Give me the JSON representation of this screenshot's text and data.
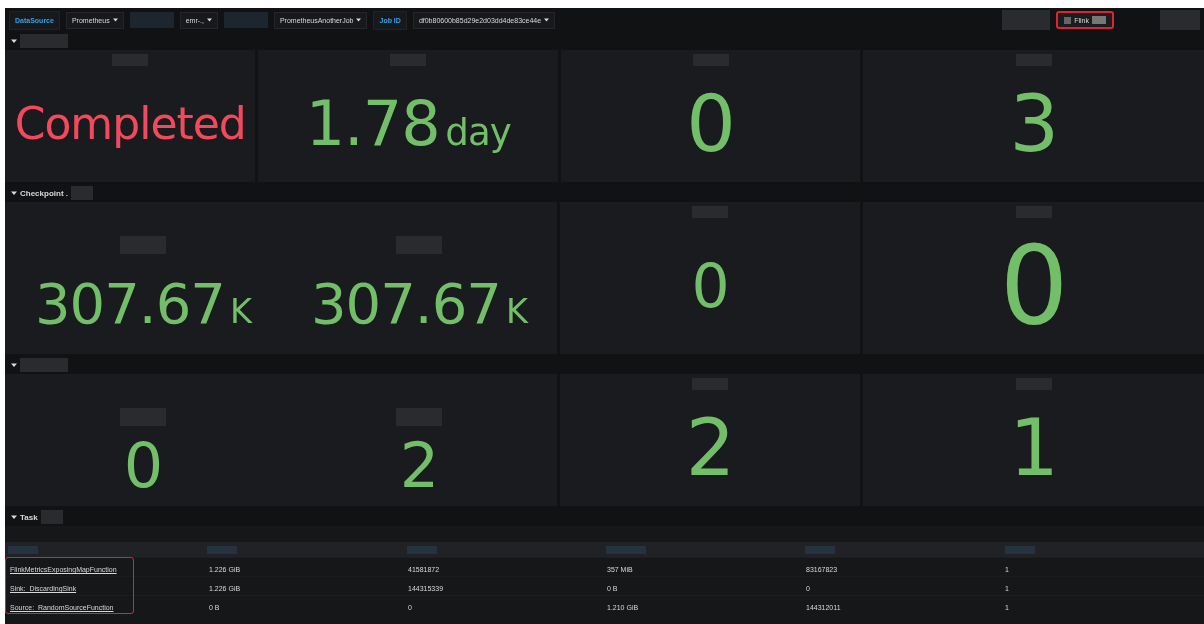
{
  "toolbar": {
    "variables": [
      {
        "label": "DataSource",
        "value": "Prometheus"
      },
      {
        "value": "emr-.,"
      },
      {
        "value": "PrometheusAnotherJob"
      },
      {
        "label": "Job ID",
        "value": "df0b80600b85d29e2d03dd4de83ce44e"
      }
    ],
    "flink_button": {
      "label": "Flink",
      "highlighted": true
    }
  },
  "sections": [
    {
      "expanded": true,
      "panels": [
        {
          "stats": [
            {
              "value": "Completed",
              "color": "#f2495c"
            }
          ]
        },
        {
          "stats": [
            {
              "value": "1.78",
              "unit": "day",
              "color": "#73bf69"
            }
          ]
        },
        {
          "stats": [
            {
              "value": "0",
              "color": "#73bf69"
            }
          ]
        },
        {
          "stats": [
            {
              "value": "3",
              "color": "#73bf69"
            }
          ]
        }
      ]
    },
    {
      "title": "Checkpoint .",
      "expanded": true,
      "panels": [
        {
          "stats": [
            {
              "value": "307.67",
              "unit": "K",
              "color": "#73bf69"
            },
            {
              "value": "307.67",
              "unit": "K",
              "color": "#73bf69"
            }
          ]
        },
        {
          "stats": [
            {
              "value": "0",
              "color": "#73bf69"
            }
          ]
        },
        {
          "stats": [
            {
              "value": "0",
              "color": "#73bf69"
            }
          ]
        }
      ]
    },
    {
      "expanded": true,
      "panels": [
        {
          "stats": [
            {
              "value": "0",
              "color": "#73bf69"
            },
            {
              "value": "2",
              "color": "#73bf69"
            }
          ]
        },
        {
          "stats": [
            {
              "value": "2",
              "color": "#73bf69"
            }
          ]
        },
        {
          "stats": [
            {
              "value": "1",
              "color": "#73bf69"
            }
          ]
        }
      ]
    },
    {
      "title": "Task",
      "expanded": true,
      "table": {
        "first_column_highlighted": true,
        "rows": [
          {
            "cells": [
              "FlinkMetricsExposingMapFunction",
              "1.226 GiB",
              "41581872",
              "357 MiB",
              "83167823",
              "1"
            ]
          },
          {
            "cells": [
              "Sink:_DiscardingSink",
              "1.226 GiB",
              "144315339",
              "0 B",
              "0",
              "1"
            ]
          },
          {
            "cells": [
              "Source:_RandomSourceFunction",
              "0 B",
              "0",
              "1.210 GiB",
              "144312011",
              "1"
            ]
          }
        ]
      }
    }
  ]
}
